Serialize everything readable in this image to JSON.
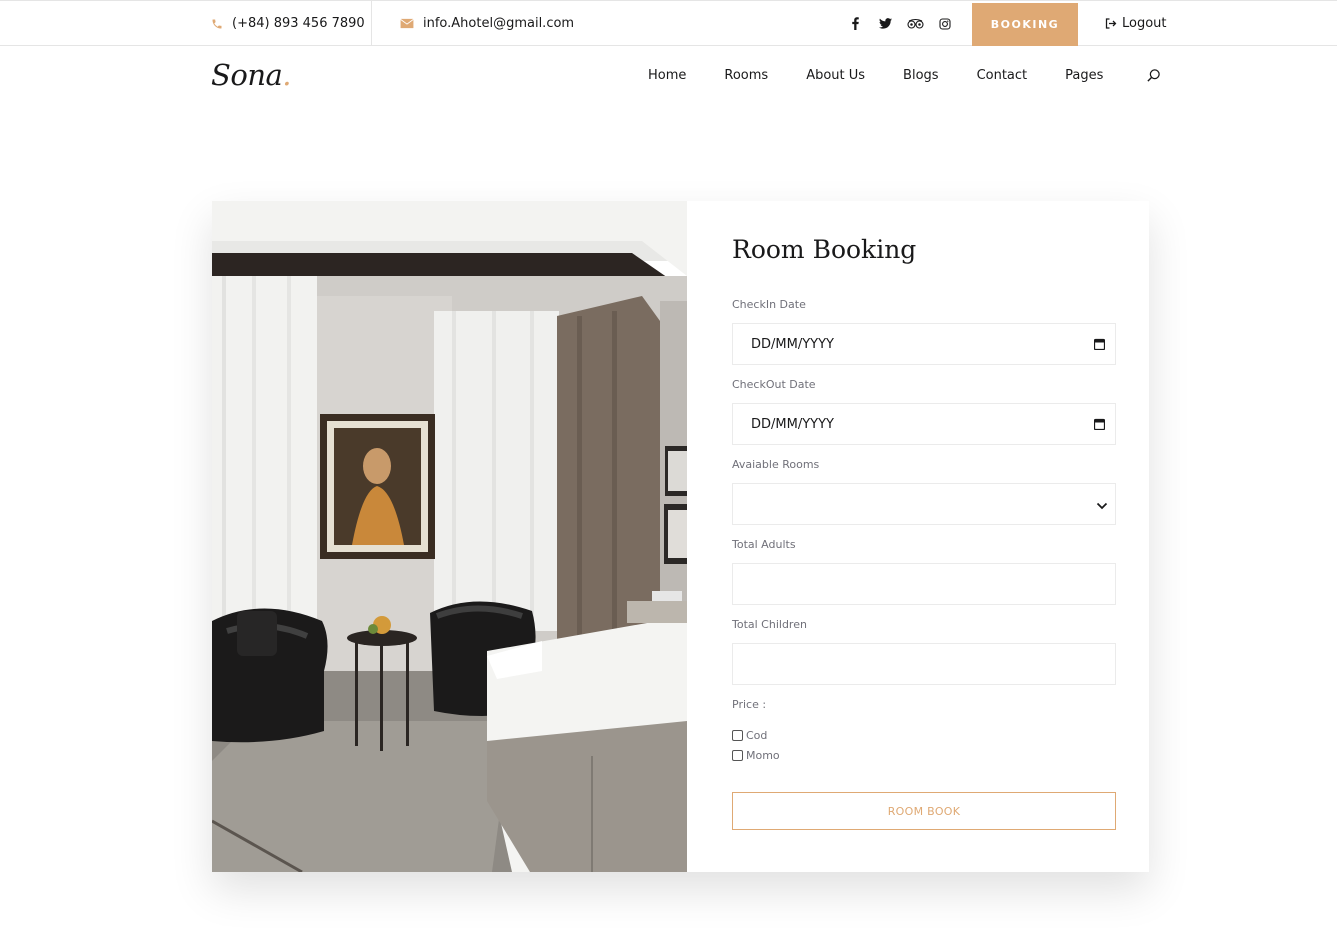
{
  "topbar": {
    "phone": "(+84) 893 456 7890",
    "email": "info.Ahotel@gmail.com",
    "social_icons": [
      "facebook-icon",
      "twitter-icon",
      "tripadvisor-icon",
      "instagram-icon"
    ],
    "booking_label": "BOOKING",
    "logout_label": "Logout"
  },
  "header": {
    "logo_text": "Sona",
    "logo_dot": ".",
    "nav": [
      "Home",
      "Rooms",
      "About Us",
      "Blogs",
      "Contact",
      "Pages"
    ]
  },
  "form": {
    "title": "Room Booking",
    "checkin_label": "CheckIn Date",
    "checkin_value": "DD/MM/YYYY",
    "checkout_label": "CheckOut Date",
    "checkout_value": "DD/MM/YYYY",
    "rooms_label": "Avaiable Rooms",
    "rooms_value": "",
    "adults_label": "Total Adults",
    "adults_value": "",
    "children_label": "Total Children",
    "children_value": "",
    "price_label": "Price :",
    "payment_options": [
      "Cod",
      "Momo"
    ],
    "submit_label": "ROOM BOOK"
  },
  "colors": {
    "accent": "#dfa974",
    "text": "#19191a",
    "muted": "#707079",
    "border": "#ebebeb"
  }
}
